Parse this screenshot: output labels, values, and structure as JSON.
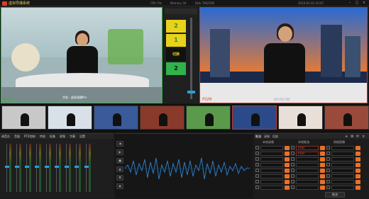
{
  "titlebar": {
    "app_title": "虚拟导播系统",
    "stats": [
      "CPU 5%",
      "Memory 44",
      "Disk 79G/500"
    ],
    "clock": "2019-01-01 10:07",
    "buttons": [
      "–",
      "□",
      "×"
    ]
  },
  "pvw": {
    "label": "PVW",
    "caption": "华思 · 虚拟演播Pro"
  },
  "pgm": {
    "label": "PGM",
    "time": "00:00:00"
  },
  "transition": {
    "buttons": [
      "2",
      "1",
      "切换",
      "2"
    ],
    "colors": {
      "yellow": "#e8d21c",
      "green": "#2fb34a",
      "blue": "#2a9ee0",
      "red": "#c0392b"
    }
  },
  "thumbnails": {
    "count": 8,
    "selected_index": 5
  },
  "mixer": {
    "tabs": [
      "调音台",
      "音量",
      "PTZ控制",
      "特效",
      "抠像",
      "视频",
      "字幕",
      "设置"
    ],
    "channels": 9,
    "fader_levels": [
      0.55,
      0.55,
      0.55,
      0.55,
      0.55,
      0.55,
      0.55,
      0.55,
      0.55
    ]
  },
  "wave": {
    "controls": [
      "◀",
      "▶",
      "■",
      "▲",
      "▼",
      "◆"
    ]
  },
  "panel": {
    "tabs": [
      "推流",
      "录制",
      "回放"
    ],
    "columns": [
      "本地录像",
      "本地推流",
      "网络直播"
    ],
    "rows": [
      {
        "label": "1",
        "value": "RTMP"
      },
      {
        "label": "2",
        "value": "RTMP"
      },
      {
        "label": "3",
        "value": ""
      },
      {
        "label": "4",
        "value": ""
      },
      {
        "label": "5",
        "value": ""
      },
      {
        "label": "6",
        "value": ""
      },
      {
        "label": "7",
        "value": ""
      },
      {
        "label": "8",
        "value": ""
      }
    ],
    "apply": "推流",
    "icons": [
      "+",
      "⚙",
      "⟳",
      "×"
    ]
  }
}
